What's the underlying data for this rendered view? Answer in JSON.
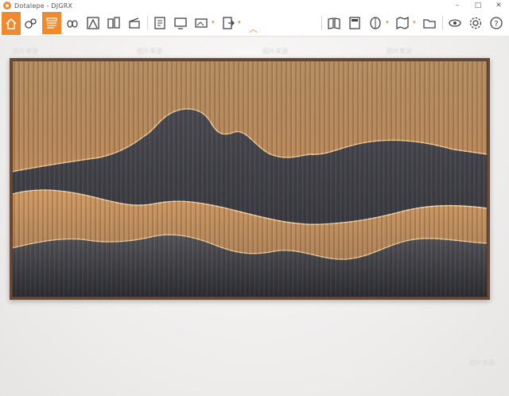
{
  "window": {
    "title": "Dotalepe - DJGRX",
    "minimize_icon": "minimize-icon",
    "maximize_icon": "maximize-icon",
    "close_icon": "close-icon"
  },
  "toolbar": {
    "home": "home-icon",
    "tools": [
      "shapes-icon",
      "grid-active-icon",
      "eyes-icon",
      "triangle-frame-icon",
      "gallery-icon",
      "clapper-icon",
      "document-icon",
      "screen-icon",
      "image-edit-icon",
      "export-icon",
      "book-icon",
      "calculator-icon",
      "diamond-icon",
      "map-icon",
      "folder-icon",
      "view-icon",
      "gear-icon",
      "help-icon"
    ],
    "collapse": "chevron-up-icon"
  },
  "watermarks": [
    "图片来源",
    "图片来源",
    "图片来源",
    "图片来源",
    "图片来源"
  ],
  "colors": {
    "accent": "#f08a2c",
    "frame": "#6a4a33",
    "slat_light": "#c99a63",
    "slat_dark": "#3d3e46",
    "glow": "#ffd9a0"
  },
  "artwork": "mountain-slat-wall-panel"
}
